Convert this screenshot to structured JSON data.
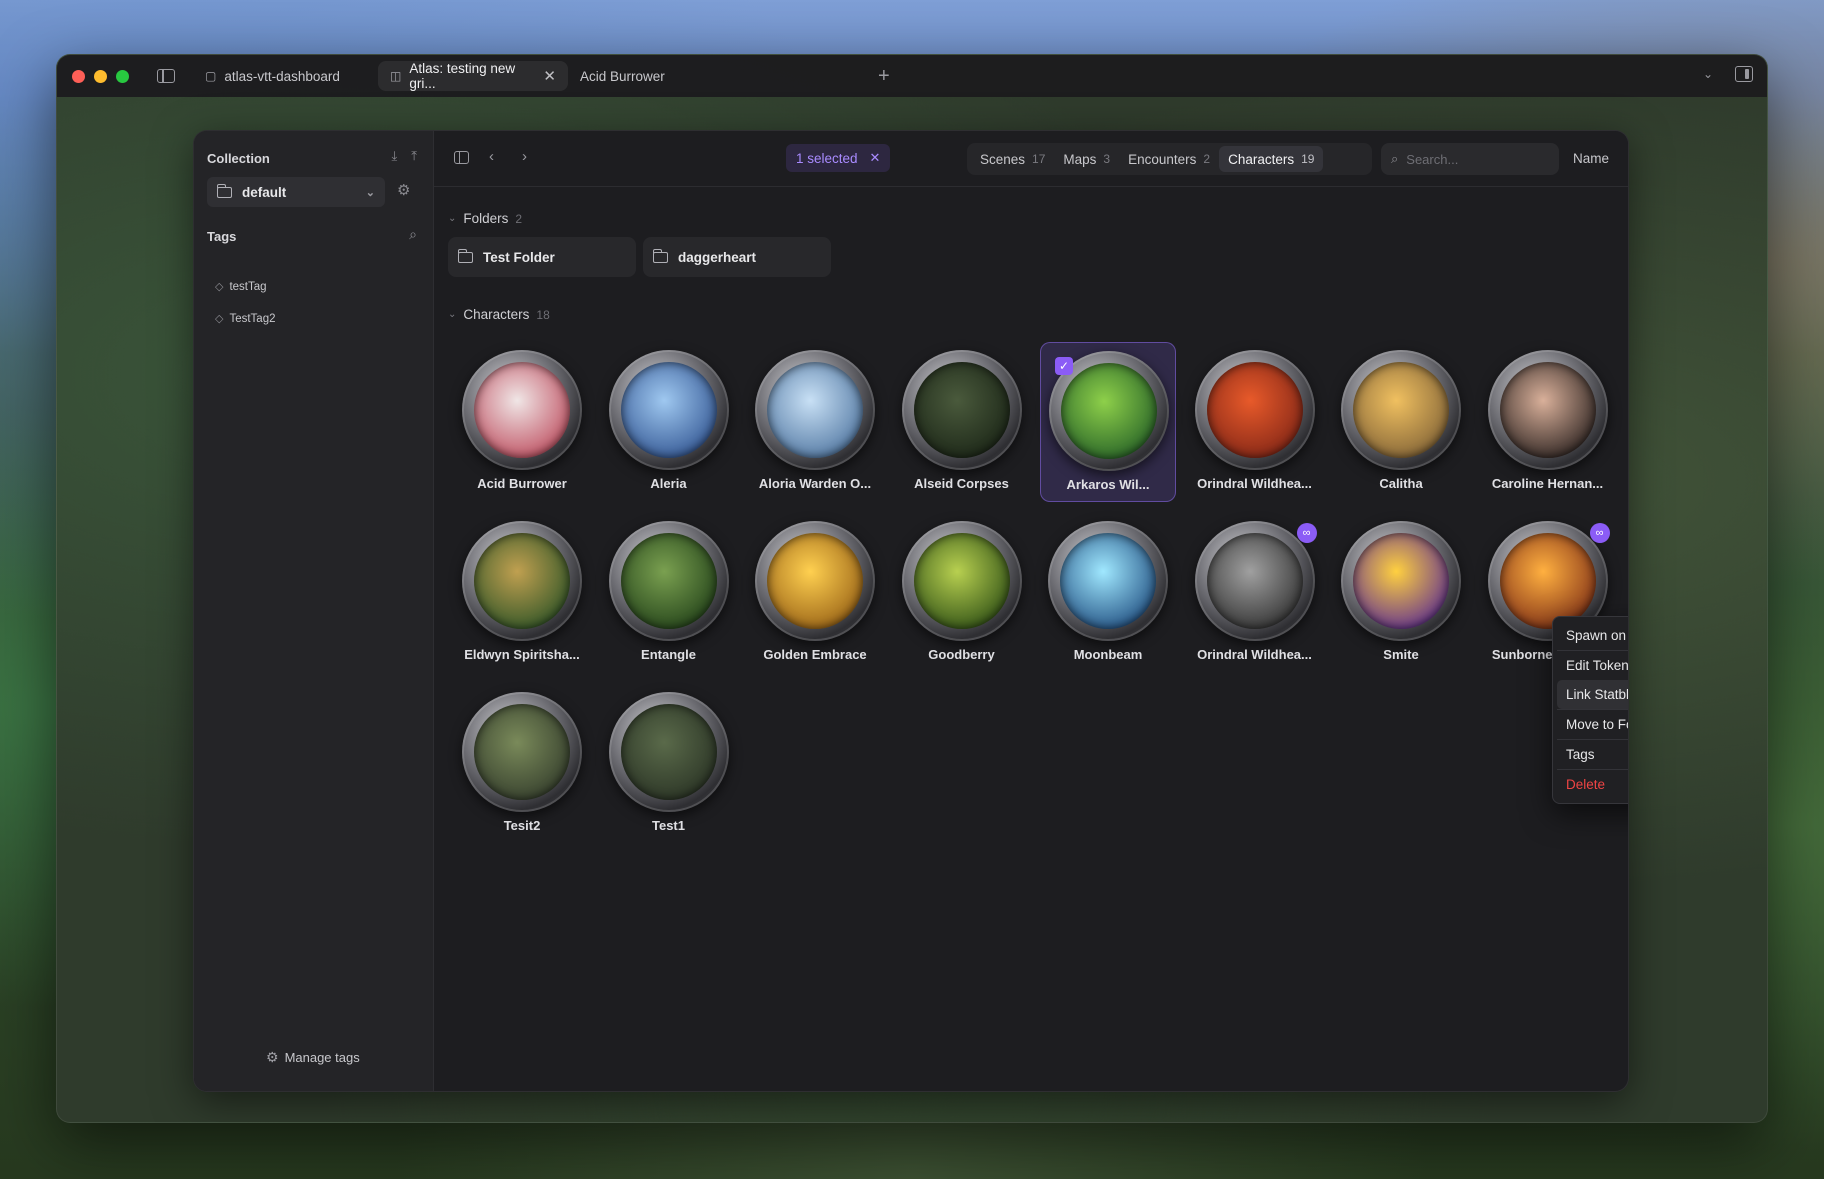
{
  "browser": {
    "tabs": [
      {
        "label": "atlas-vtt-dashboard",
        "icon": "doc-icon"
      },
      {
        "label": "Atlas: testing new gri...",
        "icon": "map-icon",
        "active": true
      },
      {
        "label": "Acid Burrower"
      }
    ]
  },
  "sidebar": {
    "collection_label": "Collection",
    "collection_value": "default",
    "tags_label": "Tags",
    "tags": [
      "testTag",
      "TestTag2"
    ],
    "manage_tags": "Manage tags"
  },
  "toolbar": {
    "selected_chip": "1 selected",
    "segments": [
      {
        "label": "Scenes",
        "count": "17"
      },
      {
        "label": "Maps",
        "count": "3"
      },
      {
        "label": "Encounters",
        "count": "2"
      },
      {
        "label": "Characters",
        "count": "19",
        "active": true
      }
    ],
    "search_placeholder": "Search...",
    "sort_label": "Name",
    "accent_color": "#8b5cf6"
  },
  "folders_section": {
    "label": "Folders",
    "count": "2",
    "items": [
      "Test Folder",
      "daggerheart"
    ]
  },
  "characters_section": {
    "label": "Characters",
    "count": "18",
    "items": [
      {
        "name": "Acid Burrower",
        "colors": [
          "#f0e6e6",
          "#c25a6a"
        ]
      },
      {
        "name": "Aleria",
        "colors": [
          "#9fc8f0",
          "#3b5f9a"
        ]
      },
      {
        "name": "Aloria Warden O...",
        "colors": [
          "#c8e0f5",
          "#5a7fa8"
        ]
      },
      {
        "name": "Alseid Corpses",
        "colors": [
          "#4a5a3c",
          "#1f2a1a"
        ]
      },
      {
        "name": "Arkaros Wil...",
        "colors": [
          "#8ed04a",
          "#2e6a2a"
        ],
        "selected": true
      },
      {
        "name": "Orindral Wildhea...",
        "colors": [
          "#e85a2a",
          "#8a2a18"
        ]
      },
      {
        "name": "Calitha",
        "colors": [
          "#f0c060",
          "#8a6a3a"
        ]
      },
      {
        "name": "Caroline Hernan...",
        "colors": [
          "#d9b09a",
          "#3a2e2a"
        ]
      },
      {
        "name": "Eldwyn Spiritsha...",
        "colors": [
          "#c0a050",
          "#3a5a2a"
        ]
      },
      {
        "name": "Entangle",
        "colors": [
          "#7aa050",
          "#2a4a1e"
        ]
      },
      {
        "name": "Golden Embrace",
        "colors": [
          "#ffd050",
          "#a06a1a"
        ]
      },
      {
        "name": "Goodberry",
        "colors": [
          "#b8d050",
          "#3a5a1a"
        ]
      },
      {
        "name": "Moonbeam",
        "colors": [
          "#a0e8ff",
          "#2a5a8a"
        ]
      },
      {
        "name": "Orindral Wildhea...",
        "colors": [
          "#a0a0a0",
          "#3a3a3a"
        ],
        "linked": true
      },
      {
        "name": "Smite",
        "colors": [
          "#ffd040",
          "#6a3a8a"
        ]
      },
      {
        "name": "Sunborne Beacon",
        "colors": [
          "#ffb040",
          "#8a3a1a"
        ],
        "linked": true
      },
      {
        "name": "Tesit2",
        "colors": [
          "#7a8a5a",
          "#3a4430"
        ]
      },
      {
        "name": "Test1",
        "colors": [
          "#5a6a4a",
          "#2e3828"
        ]
      }
    ]
  },
  "context_menu": {
    "items": [
      "Spawn on Map",
      "Edit Token",
      "Link Statblock",
      "Move to Folder",
      "Tags",
      "Delete"
    ]
  }
}
